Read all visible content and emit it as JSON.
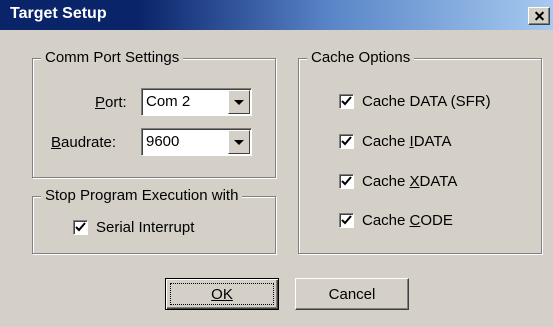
{
  "window": {
    "title": "Target Setup"
  },
  "comm": {
    "legend": "Comm Port Settings",
    "port": {
      "label_accel": "P",
      "label_rest": "ort:",
      "value": "Com 2"
    },
    "baud": {
      "label_accel": "B",
      "label_rest": "audrate:",
      "value": "9600"
    }
  },
  "stop": {
    "legend": "Stop Program Execution with",
    "serial_interrupt": {
      "label": "Serial Interrupt",
      "checked": true
    }
  },
  "cache": {
    "legend": "Cache Options",
    "items": [
      {
        "pre": "Cache DATA (SFR)",
        "accel": "",
        "post": "",
        "checked": true
      },
      {
        "pre": "Cache ",
        "accel": "I",
        "post": "DATA",
        "checked": true
      },
      {
        "pre": "Cache ",
        "accel": "X",
        "post": "DATA",
        "checked": true
      },
      {
        "pre": "Cache ",
        "accel": "C",
        "post": "ODE",
        "checked": true
      }
    ]
  },
  "buttons": {
    "ok": "OK",
    "cancel": "Cancel"
  }
}
